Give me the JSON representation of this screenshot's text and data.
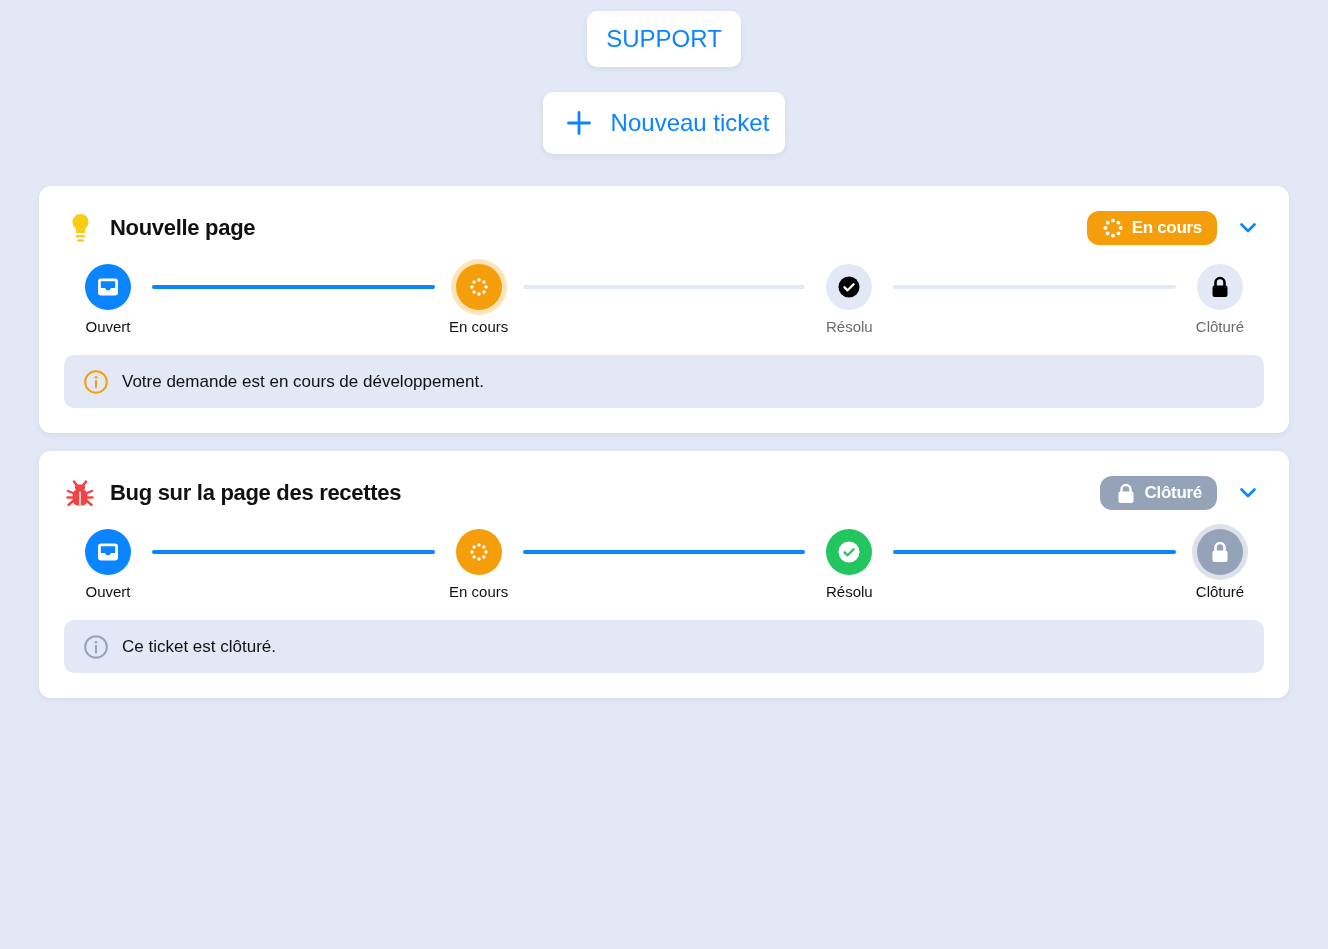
{
  "header": {
    "title": "SUPPORT"
  },
  "new_ticket_button": {
    "label": "Nouveau ticket"
  },
  "tickets": [
    {
      "kind": "idea",
      "title": "Nouvelle page",
      "status": {
        "kind": "in_progress",
        "label": "En cours"
      },
      "steps": [
        {
          "kind": "open",
          "label": "Ouvert",
          "reached": true,
          "active": false
        },
        {
          "kind": "in_progress",
          "label": "En cours",
          "reached": true,
          "active": true
        },
        {
          "kind": "resolved",
          "label": "Résolu",
          "reached": false,
          "active": false
        },
        {
          "kind": "closed",
          "label": "Clôturé",
          "reached": false,
          "active": false
        }
      ],
      "notice": "Votre demande est en cours de développement."
    },
    {
      "kind": "bug",
      "title": "Bug sur la page des recettes",
      "status": {
        "kind": "closed",
        "label": "Clôturé"
      },
      "steps": [
        {
          "kind": "open",
          "label": "Ouvert",
          "reached": true,
          "active": false
        },
        {
          "kind": "in_progress",
          "label": "En cours",
          "reached": true,
          "active": false
        },
        {
          "kind": "resolved",
          "label": "Résolu",
          "reached": true,
          "active": false
        },
        {
          "kind": "closed",
          "label": "Clôturé",
          "reached": true,
          "active": true
        }
      ],
      "notice": "Ce ticket est clôturé."
    }
  ]
}
